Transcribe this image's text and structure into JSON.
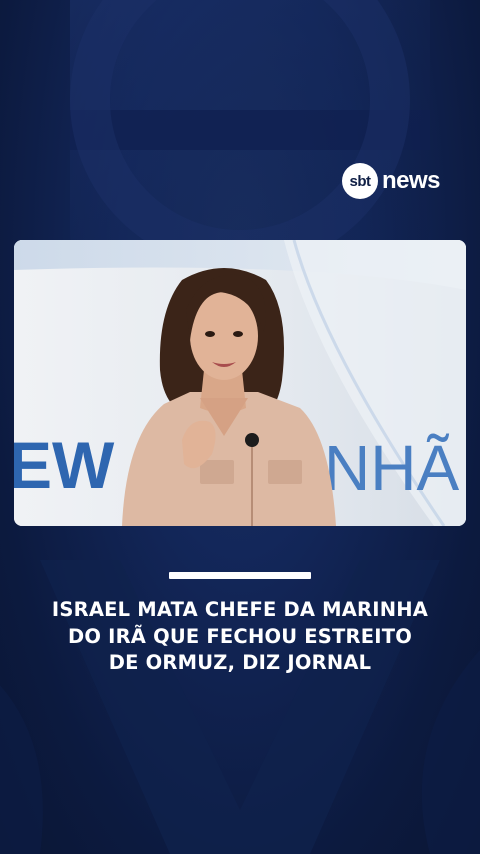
{
  "brand": {
    "logo_mark": "sbt",
    "logo_text": "news"
  },
  "video": {
    "backdrop_text_left": "EW",
    "backdrop_text_right": "NHÃ"
  },
  "headline": {
    "lines": [
      "ISRAEL MATA CHEFE DA MARINHA",
      "DO IRÃ QUE FECHOU ESTREITO",
      "DE ORMUZ, DIZ JORNAL"
    ]
  },
  "colors": {
    "background": "#13275a",
    "accent_white": "#ffffff",
    "studio_text_blue": "#2e66b0"
  }
}
